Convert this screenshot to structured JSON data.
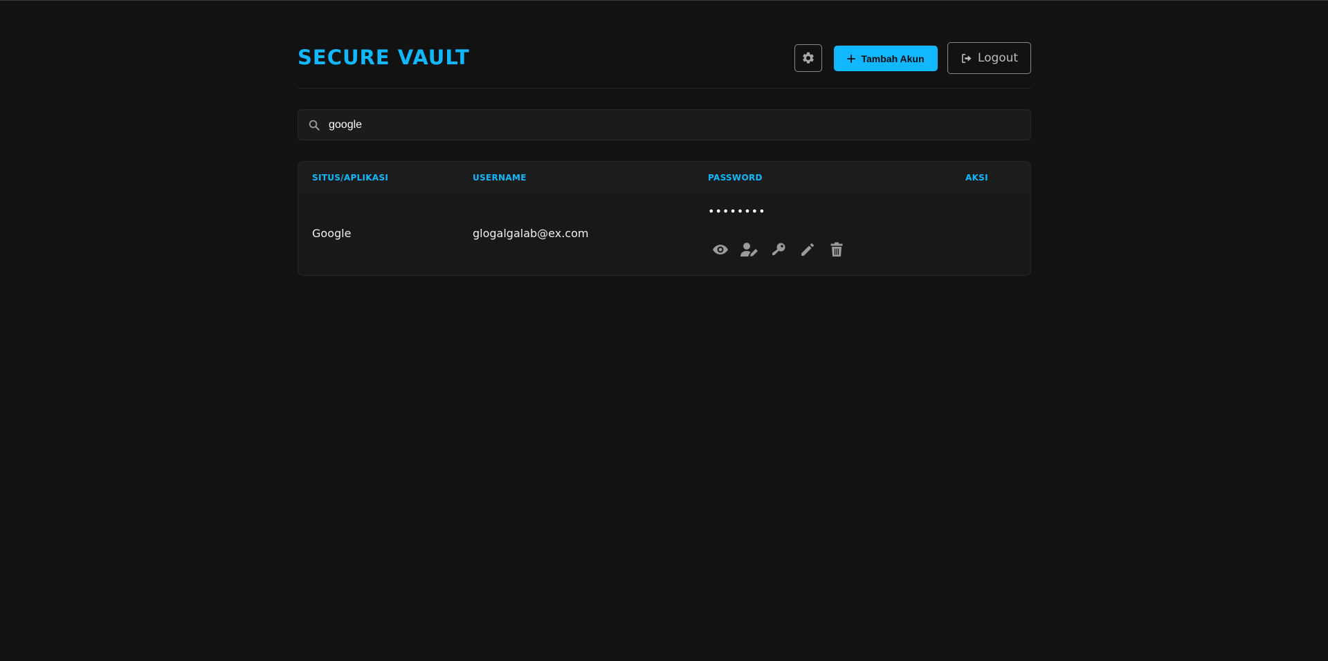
{
  "app": {
    "brand": "SECURE VAULT"
  },
  "header": {
    "settings_icon": "gear-icon",
    "add_label": "Tambah Akun",
    "add_icon": "plus-icon",
    "logout_label": "Logout",
    "logout_icon": "sign-out-icon"
  },
  "search": {
    "value": "google",
    "icon": "search-icon"
  },
  "table": {
    "columns": [
      "SITUS/APLIKASI",
      "USERNAME",
      "PASSWORD",
      "AKSI"
    ],
    "rows": [
      {
        "site": "Google",
        "username": "glogalgalab@ex.com",
        "password_masked": "••••••••",
        "actions": [
          "eye-icon",
          "user-edit-icon",
          "key-icon",
          "pencil-icon",
          "trash-icon"
        ]
      }
    ]
  },
  "colors": {
    "accent": "#12b8ff",
    "background": "#121212",
    "surface": "#1b1b1b",
    "icon_gray": "#9a9a9a"
  }
}
